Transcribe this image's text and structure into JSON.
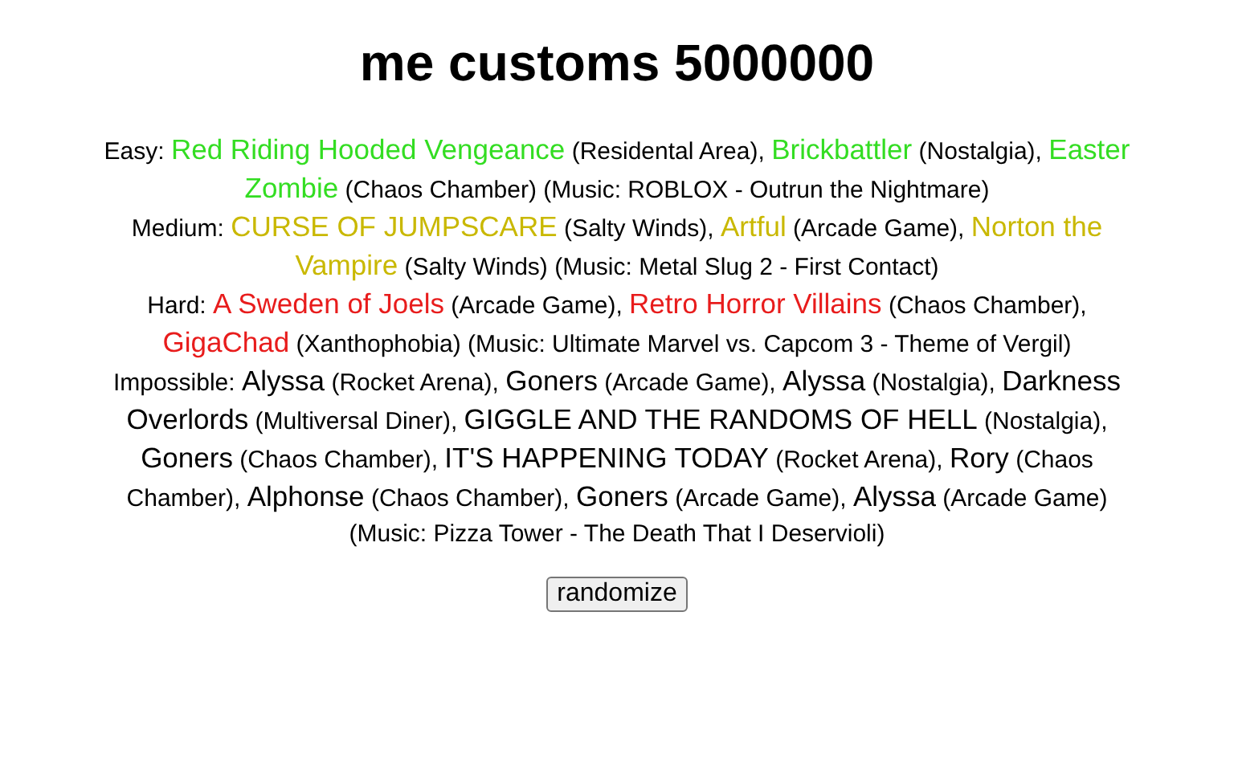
{
  "title": "me customs 5000000",
  "separator": ", ",
  "tiers": [
    {
      "label": "Easy:",
      "color": "#33dd22",
      "entries": [
        {
          "name": "Red Riding Hooded Vengeance",
          "location": "(Residental Area)"
        },
        {
          "name": "Brickbattler",
          "location": "(Nostalgia)"
        },
        {
          "name": "Easter Zombie",
          "location": "(Chaos Chamber)"
        }
      ],
      "music": "(Music: ROBLOX - Outrun the Nightmare)"
    },
    {
      "label": "Medium:",
      "color": "#c9b800",
      "entries": [
        {
          "name": "CURSE OF JUMPSCARE",
          "location": "(Salty Winds)"
        },
        {
          "name": "Artful",
          "location": "(Arcade Game)"
        },
        {
          "name": "Norton the Vampire",
          "location": "(Salty Winds)"
        }
      ],
      "music": "(Music: Metal Slug 2 - First Contact)"
    },
    {
      "label": "Hard:",
      "color": "#e81c1c",
      "entries": [
        {
          "name": "A Sweden of Joels",
          "location": "(Arcade Game)"
        },
        {
          "name": "Retro Horror Villains",
          "location": "(Chaos Chamber)"
        },
        {
          "name": "GigaChad",
          "location": "(Xanthophobia)"
        }
      ],
      "music": "(Music: Ultimate Marvel vs. Capcom 3 - Theme of Vergil)"
    },
    {
      "label": "Impossible:",
      "color": "#000000",
      "entries": [
        {
          "name": "Alyssa",
          "location": "(Rocket Arena)"
        },
        {
          "name": "Goners",
          "location": "(Arcade Game)"
        },
        {
          "name": "Alyssa",
          "location": "(Nostalgia)"
        },
        {
          "name": "Darkness Overlords",
          "location": "(Multiversal Diner)"
        },
        {
          "name": "GIGGLE AND THE RANDOMS OF HELL",
          "location": "(Nostalgia)"
        },
        {
          "name": "Goners",
          "location": "(Chaos Chamber)"
        },
        {
          "name": "IT'S HAPPENING TODAY",
          "location": "(Rocket Arena)"
        },
        {
          "name": "Rory",
          "location": "(Chaos Chamber)"
        },
        {
          "name": "Alphonse",
          "location": "(Chaos Chamber)"
        },
        {
          "name": "Goners",
          "location": "(Arcade Game)"
        },
        {
          "name": "Alyssa",
          "location": "(Arcade Game)"
        }
      ],
      "music": "(Music: Pizza Tower - The Death That I Deservioli)"
    }
  ],
  "button": "randomize"
}
